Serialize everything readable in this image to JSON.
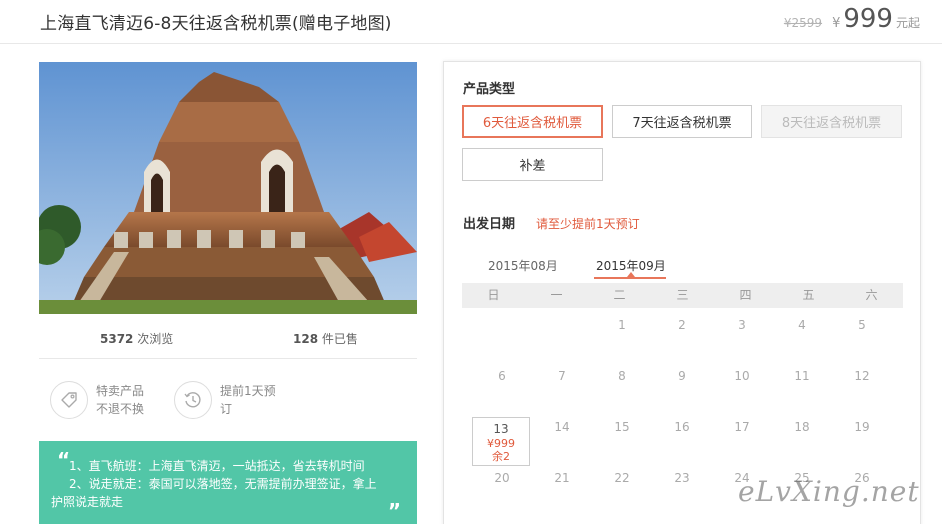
{
  "header": {
    "title": "上海直飞清迈6-8天往返含税机票(赠电子地图)",
    "old_price": "¥2599",
    "currency": "¥",
    "price": "999",
    "price_suffix": "元起"
  },
  "stats": {
    "views_count": "5372",
    "views_label": "次浏览",
    "sold_count": "128",
    "sold_label": "件已售"
  },
  "features": [
    {
      "icon": "tag-icon",
      "line1": "特卖产品",
      "line2": "不退不换"
    },
    {
      "icon": "clock-history-icon",
      "line1": "提前1天预",
      "line2": "订"
    }
  ],
  "highlights": {
    "open_quote": "“",
    "close_quote": "”",
    "line1": "1、直飞航班：上海直飞清迈，一站抵达，省去转机时间",
    "line2": "2、说走就走：泰国可以落地签，无需提前办理签证，拿上",
    "line3": "护照说走就走"
  },
  "panel": {
    "type_label": "产品类型",
    "options": [
      "6天往返含税机票",
      "7天往返含税机票",
      "8天往返含税机票",
      "补差"
    ],
    "date_label": "出发日期",
    "notice": "请至少提前1天预订",
    "months": [
      "2015年08月",
      "2015年09月"
    ],
    "weekdays": [
      "日",
      "一",
      "二",
      "三",
      "四",
      "五",
      "六"
    ],
    "week1": [
      "1",
      "2",
      "3",
      "4",
      "5"
    ],
    "week2": [
      "6",
      "7",
      "8",
      "9",
      "10",
      "11",
      "12"
    ],
    "week3_active": {
      "day": "13",
      "price": "¥999",
      "stock": "余2"
    },
    "week3": [
      "14",
      "15",
      "16",
      "17",
      "18",
      "19"
    ],
    "week4": [
      "20",
      "21",
      "22",
      "23",
      "24",
      "25",
      "26"
    ]
  },
  "watermark": "eLvXing.net",
  "colors": {
    "accent": "#e8765a",
    "accent_text": "#e05a3c",
    "green": "#52c6a7"
  }
}
